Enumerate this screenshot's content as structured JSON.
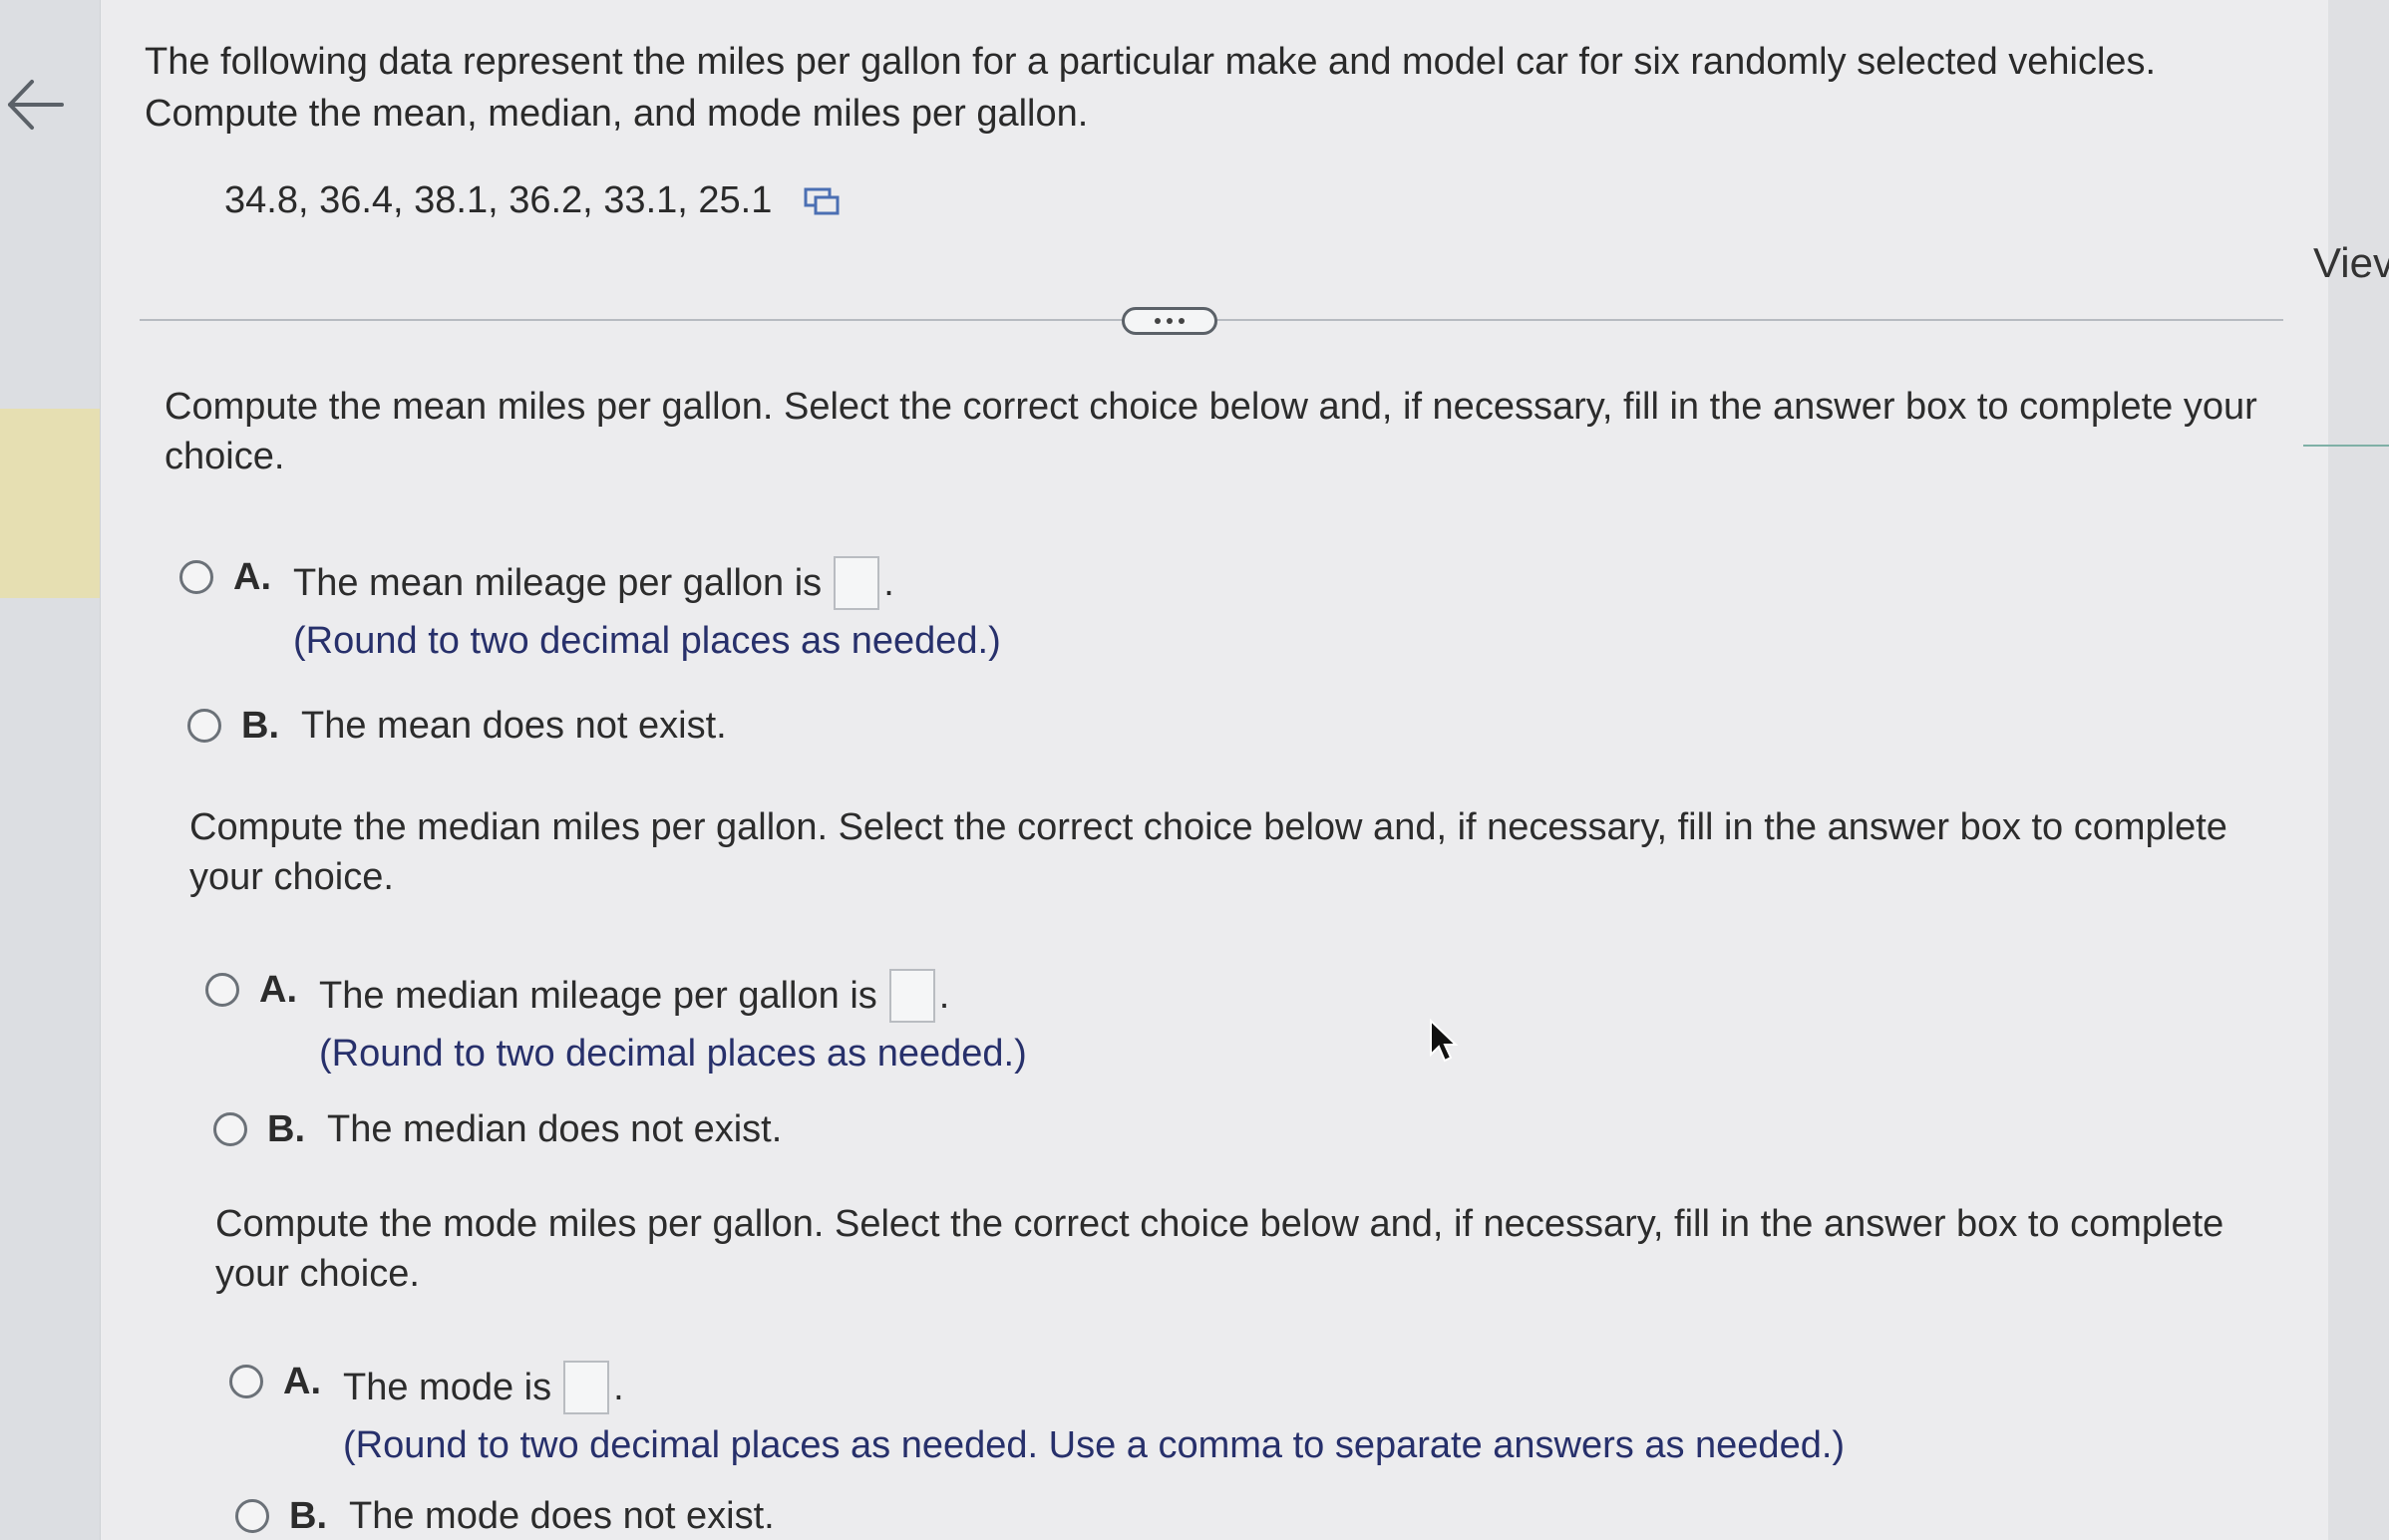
{
  "prompt": {
    "line1": "The following data represent the miles per gallon for a particular make and model car for six randomly selected vehicles.",
    "line2": "Compute the mean, median, and mode miles per gallon."
  },
  "data_values": "34.8, 36.4, 38.1, 36.2, 33.1, 25.1",
  "right_panel_label": "Viev",
  "questions": [
    {
      "text": "Compute the mean miles per gallon. Select the correct choice below and, if necessary, fill in the answer box to complete your choice.",
      "choice_a_letter": "A.",
      "choice_a_text": "The mean mileage per gallon is",
      "choice_a_hint": "(Round to two decimal places as needed.)",
      "choice_b_letter": "B.",
      "choice_b_text": "The mean does not exist."
    },
    {
      "text": "Compute the median miles per gallon. Select the correct choice below and, if necessary, fill in the answer box to complete your choice.",
      "choice_a_letter": "A.",
      "choice_a_text": "The median mileage per gallon is",
      "choice_a_hint": "(Round to two decimal places as needed.)",
      "choice_b_letter": "B.",
      "choice_b_text": "The median does not exist."
    },
    {
      "text": "Compute the mode miles per gallon. Select the correct choice below and, if necessary, fill in the answer box to complete your choice.",
      "choice_a_letter": "A.",
      "choice_a_text": "The mode is",
      "choice_a_hint": "(Round to two decimal places as needed. Use a comma to separate answers as needed.)",
      "choice_b_letter": "B.",
      "choice_b_text": "The mode does not exist."
    }
  ],
  "period": ".",
  "icons": {
    "back": "arrow-left-icon",
    "copy": "copy-icon",
    "more": "ellipsis-icon",
    "cursor": "mouse-pointer-icon"
  }
}
